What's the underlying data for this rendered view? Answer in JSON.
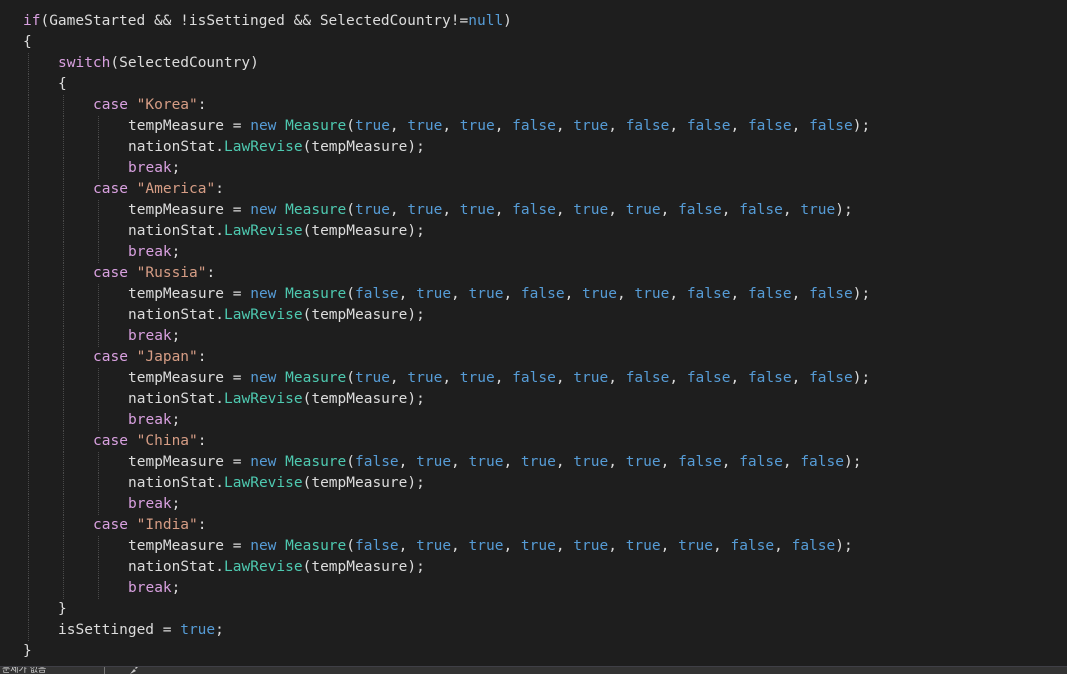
{
  "editor": {
    "lines": [
      {
        "indent": 0,
        "tokens": [
          {
            "t": "ctl",
            "v": "if"
          },
          {
            "t": "pl",
            "v": "(GameStarted && !isSettinged && SelectedCountry"
          },
          {
            "t": "pl",
            "v": "!="
          },
          {
            "t": "kw",
            "v": "null"
          },
          {
            "t": "pl",
            "v": ")"
          }
        ]
      },
      {
        "indent": 0,
        "tokens": [
          {
            "t": "pl",
            "v": "{"
          }
        ]
      },
      {
        "indent": 1,
        "tokens": [
          {
            "t": "ctl",
            "v": "switch"
          },
          {
            "t": "pl",
            "v": "(SelectedCountry)"
          }
        ]
      },
      {
        "indent": 1,
        "tokens": [
          {
            "t": "pl",
            "v": "{"
          }
        ]
      },
      {
        "indent": 2,
        "tokens": [
          {
            "t": "ctl",
            "v": "case"
          },
          {
            "t": "pl",
            "v": " "
          },
          {
            "t": "str",
            "v": "\"Korea\""
          },
          {
            "t": "pl",
            "v": ":"
          }
        ]
      },
      {
        "indent": 3,
        "tokens": [
          {
            "t": "pl",
            "v": "tempMeasure = "
          },
          {
            "t": "kw",
            "v": "new"
          },
          {
            "t": "pl",
            "v": " "
          },
          {
            "t": "typ",
            "v": "Measure"
          },
          {
            "t": "pl",
            "v": "("
          },
          {
            "t": "kw",
            "v": "true"
          },
          {
            "t": "pl",
            "v": ", "
          },
          {
            "t": "kw",
            "v": "true"
          },
          {
            "t": "pl",
            "v": ", "
          },
          {
            "t": "kw",
            "v": "true"
          },
          {
            "t": "pl",
            "v": ", "
          },
          {
            "t": "kw",
            "v": "false"
          },
          {
            "t": "pl",
            "v": ", "
          },
          {
            "t": "kw",
            "v": "true"
          },
          {
            "t": "pl",
            "v": ", "
          },
          {
            "t": "kw",
            "v": "false"
          },
          {
            "t": "pl",
            "v": ", "
          },
          {
            "t": "kw",
            "v": "false"
          },
          {
            "t": "pl",
            "v": ", "
          },
          {
            "t": "kw",
            "v": "false"
          },
          {
            "t": "pl",
            "v": ", "
          },
          {
            "t": "kw",
            "v": "false"
          },
          {
            "t": "pl",
            "v": ");"
          }
        ]
      },
      {
        "indent": 3,
        "tokens": [
          {
            "t": "pl",
            "v": "nationStat."
          },
          {
            "t": "mth",
            "v": "LawRevise"
          },
          {
            "t": "pl",
            "v": "(tempMeasure);"
          }
        ]
      },
      {
        "indent": 3,
        "tokens": [
          {
            "t": "ctl",
            "v": "break"
          },
          {
            "t": "pl",
            "v": ";"
          }
        ]
      },
      {
        "indent": 2,
        "tokens": [
          {
            "t": "ctl",
            "v": "case"
          },
          {
            "t": "pl",
            "v": " "
          },
          {
            "t": "str",
            "v": "\"America\""
          },
          {
            "t": "pl",
            "v": ":"
          }
        ]
      },
      {
        "indent": 3,
        "tokens": [
          {
            "t": "pl",
            "v": "tempMeasure = "
          },
          {
            "t": "kw",
            "v": "new"
          },
          {
            "t": "pl",
            "v": " "
          },
          {
            "t": "typ",
            "v": "Measure"
          },
          {
            "t": "pl",
            "v": "("
          },
          {
            "t": "kw",
            "v": "true"
          },
          {
            "t": "pl",
            "v": ", "
          },
          {
            "t": "kw",
            "v": "true"
          },
          {
            "t": "pl",
            "v": ", "
          },
          {
            "t": "kw",
            "v": "true"
          },
          {
            "t": "pl",
            "v": ", "
          },
          {
            "t": "kw",
            "v": "false"
          },
          {
            "t": "pl",
            "v": ", "
          },
          {
            "t": "kw",
            "v": "true"
          },
          {
            "t": "pl",
            "v": ", "
          },
          {
            "t": "kw",
            "v": "true"
          },
          {
            "t": "pl",
            "v": ", "
          },
          {
            "t": "kw",
            "v": "false"
          },
          {
            "t": "pl",
            "v": ", "
          },
          {
            "t": "kw",
            "v": "false"
          },
          {
            "t": "pl",
            "v": ", "
          },
          {
            "t": "kw",
            "v": "true"
          },
          {
            "t": "pl",
            "v": ");"
          }
        ]
      },
      {
        "indent": 3,
        "tokens": [
          {
            "t": "pl",
            "v": "nationStat."
          },
          {
            "t": "mth",
            "v": "LawRevise"
          },
          {
            "t": "pl",
            "v": "(tempMeasure);"
          }
        ]
      },
      {
        "indent": 3,
        "tokens": [
          {
            "t": "ctl",
            "v": "break"
          },
          {
            "t": "pl",
            "v": ";"
          }
        ]
      },
      {
        "indent": 2,
        "tokens": [
          {
            "t": "ctl",
            "v": "case"
          },
          {
            "t": "pl",
            "v": " "
          },
          {
            "t": "str",
            "v": "\"Russia\""
          },
          {
            "t": "pl",
            "v": ":"
          }
        ]
      },
      {
        "indent": 3,
        "tokens": [
          {
            "t": "pl",
            "v": "tempMeasure = "
          },
          {
            "t": "kw",
            "v": "new"
          },
          {
            "t": "pl",
            "v": " "
          },
          {
            "t": "typ",
            "v": "Measure"
          },
          {
            "t": "pl",
            "v": "("
          },
          {
            "t": "kw",
            "v": "false"
          },
          {
            "t": "pl",
            "v": ", "
          },
          {
            "t": "kw",
            "v": "true"
          },
          {
            "t": "pl",
            "v": ", "
          },
          {
            "t": "kw",
            "v": "true"
          },
          {
            "t": "pl",
            "v": ", "
          },
          {
            "t": "kw",
            "v": "false"
          },
          {
            "t": "pl",
            "v": ", "
          },
          {
            "t": "kw",
            "v": "true"
          },
          {
            "t": "pl",
            "v": ", "
          },
          {
            "t": "kw",
            "v": "true"
          },
          {
            "t": "pl",
            "v": ", "
          },
          {
            "t": "kw",
            "v": "false"
          },
          {
            "t": "pl",
            "v": ", "
          },
          {
            "t": "kw",
            "v": "false"
          },
          {
            "t": "pl",
            "v": ", "
          },
          {
            "t": "kw",
            "v": "false"
          },
          {
            "t": "pl",
            "v": ");"
          }
        ]
      },
      {
        "indent": 3,
        "tokens": [
          {
            "t": "pl",
            "v": "nationStat."
          },
          {
            "t": "mth",
            "v": "LawRevise"
          },
          {
            "t": "pl",
            "v": "(tempMeasure);"
          }
        ]
      },
      {
        "indent": 3,
        "tokens": [
          {
            "t": "ctl",
            "v": "break"
          },
          {
            "t": "pl",
            "v": ";"
          }
        ]
      },
      {
        "indent": 2,
        "tokens": [
          {
            "t": "ctl",
            "v": "case"
          },
          {
            "t": "pl",
            "v": " "
          },
          {
            "t": "str",
            "v": "\"Japan\""
          },
          {
            "t": "pl",
            "v": ":"
          }
        ]
      },
      {
        "indent": 3,
        "tokens": [
          {
            "t": "pl",
            "v": "tempMeasure = "
          },
          {
            "t": "kw",
            "v": "new"
          },
          {
            "t": "pl",
            "v": " "
          },
          {
            "t": "typ",
            "v": "Measure"
          },
          {
            "t": "pl",
            "v": "("
          },
          {
            "t": "kw",
            "v": "true"
          },
          {
            "t": "pl",
            "v": ", "
          },
          {
            "t": "kw",
            "v": "true"
          },
          {
            "t": "pl",
            "v": ", "
          },
          {
            "t": "kw",
            "v": "true"
          },
          {
            "t": "pl",
            "v": ", "
          },
          {
            "t": "kw",
            "v": "false"
          },
          {
            "t": "pl",
            "v": ", "
          },
          {
            "t": "kw",
            "v": "true"
          },
          {
            "t": "pl",
            "v": ", "
          },
          {
            "t": "kw",
            "v": "false"
          },
          {
            "t": "pl",
            "v": ", "
          },
          {
            "t": "kw",
            "v": "false"
          },
          {
            "t": "pl",
            "v": ", "
          },
          {
            "t": "kw",
            "v": "false"
          },
          {
            "t": "pl",
            "v": ", "
          },
          {
            "t": "kw",
            "v": "false"
          },
          {
            "t": "pl",
            "v": ");"
          }
        ]
      },
      {
        "indent": 3,
        "tokens": [
          {
            "t": "pl",
            "v": "nationStat."
          },
          {
            "t": "mth",
            "v": "LawRevise"
          },
          {
            "t": "pl",
            "v": "(tempMeasure);"
          }
        ]
      },
      {
        "indent": 3,
        "tokens": [
          {
            "t": "ctl",
            "v": "break"
          },
          {
            "t": "pl",
            "v": ";"
          }
        ]
      },
      {
        "indent": 2,
        "tokens": [
          {
            "t": "ctl",
            "v": "case"
          },
          {
            "t": "pl",
            "v": " "
          },
          {
            "t": "str",
            "v": "\"China\""
          },
          {
            "t": "pl",
            "v": ":"
          }
        ]
      },
      {
        "indent": 3,
        "tokens": [
          {
            "t": "pl",
            "v": "tempMeasure = "
          },
          {
            "t": "kw",
            "v": "new"
          },
          {
            "t": "pl",
            "v": " "
          },
          {
            "t": "typ",
            "v": "Measure"
          },
          {
            "t": "pl",
            "v": "("
          },
          {
            "t": "kw",
            "v": "false"
          },
          {
            "t": "pl",
            "v": ", "
          },
          {
            "t": "kw",
            "v": "true"
          },
          {
            "t": "pl",
            "v": ", "
          },
          {
            "t": "kw",
            "v": "true"
          },
          {
            "t": "pl",
            "v": ", "
          },
          {
            "t": "kw",
            "v": "true"
          },
          {
            "t": "pl",
            "v": ", "
          },
          {
            "t": "kw",
            "v": "true"
          },
          {
            "t": "pl",
            "v": ", "
          },
          {
            "t": "kw",
            "v": "true"
          },
          {
            "t": "pl",
            "v": ", "
          },
          {
            "t": "kw",
            "v": "false"
          },
          {
            "t": "pl",
            "v": ", "
          },
          {
            "t": "kw",
            "v": "false"
          },
          {
            "t": "pl",
            "v": ", "
          },
          {
            "t": "kw",
            "v": "false"
          },
          {
            "t": "pl",
            "v": ");"
          }
        ]
      },
      {
        "indent": 3,
        "tokens": [
          {
            "t": "pl",
            "v": "nationStat."
          },
          {
            "t": "mth",
            "v": "LawRevise"
          },
          {
            "t": "pl",
            "v": "(tempMeasure);"
          }
        ]
      },
      {
        "indent": 3,
        "tokens": [
          {
            "t": "ctl",
            "v": "break"
          },
          {
            "t": "pl",
            "v": ";"
          }
        ]
      },
      {
        "indent": 2,
        "tokens": [
          {
            "t": "ctl",
            "v": "case"
          },
          {
            "t": "pl",
            "v": " "
          },
          {
            "t": "str",
            "v": "\"India\""
          },
          {
            "t": "pl",
            "v": ":"
          }
        ]
      },
      {
        "indent": 3,
        "tokens": [
          {
            "t": "pl",
            "v": "tempMeasure = "
          },
          {
            "t": "kw",
            "v": "new"
          },
          {
            "t": "pl",
            "v": " "
          },
          {
            "t": "typ",
            "v": "Measure"
          },
          {
            "t": "pl",
            "v": "("
          },
          {
            "t": "kw",
            "v": "false"
          },
          {
            "t": "pl",
            "v": ", "
          },
          {
            "t": "kw",
            "v": "true"
          },
          {
            "t": "pl",
            "v": ", "
          },
          {
            "t": "kw",
            "v": "true"
          },
          {
            "t": "pl",
            "v": ", "
          },
          {
            "t": "kw",
            "v": "true"
          },
          {
            "t": "pl",
            "v": ", "
          },
          {
            "t": "kw",
            "v": "true"
          },
          {
            "t": "pl",
            "v": ", "
          },
          {
            "t": "kw",
            "v": "true"
          },
          {
            "t": "pl",
            "v": ", "
          },
          {
            "t": "kw",
            "v": "true"
          },
          {
            "t": "pl",
            "v": ", "
          },
          {
            "t": "kw",
            "v": "false"
          },
          {
            "t": "pl",
            "v": ", "
          },
          {
            "t": "kw",
            "v": "false"
          },
          {
            "t": "pl",
            "v": ");"
          }
        ]
      },
      {
        "indent": 3,
        "tokens": [
          {
            "t": "pl",
            "v": "nationStat."
          },
          {
            "t": "mth",
            "v": "LawRevise"
          },
          {
            "t": "pl",
            "v": "(tempMeasure);"
          }
        ]
      },
      {
        "indent": 3,
        "tokens": [
          {
            "t": "ctl",
            "v": "break"
          },
          {
            "t": "pl",
            "v": ";"
          }
        ]
      },
      {
        "indent": 1,
        "tokens": [
          {
            "t": "pl",
            "v": "}"
          }
        ]
      },
      {
        "indent": 1,
        "tokens": [
          {
            "t": "pl",
            "v": "isSettinged = "
          },
          {
            "t": "kw",
            "v": "true"
          },
          {
            "t": "pl",
            "v": ";"
          }
        ]
      },
      {
        "indent": 0,
        "tokens": [
          {
            "t": "pl",
            "v": "}"
          }
        ]
      }
    ]
  },
  "statusbar": {
    "text": "문제가 없음",
    "brush_icon": "brush-icon"
  },
  "colors": {
    "background": "#1e1e1e",
    "keyword": "#569cd6",
    "control": "#d8a0df",
    "string": "#d69d85",
    "type": "#4ec9b0",
    "plain": "#dcdcdc"
  }
}
